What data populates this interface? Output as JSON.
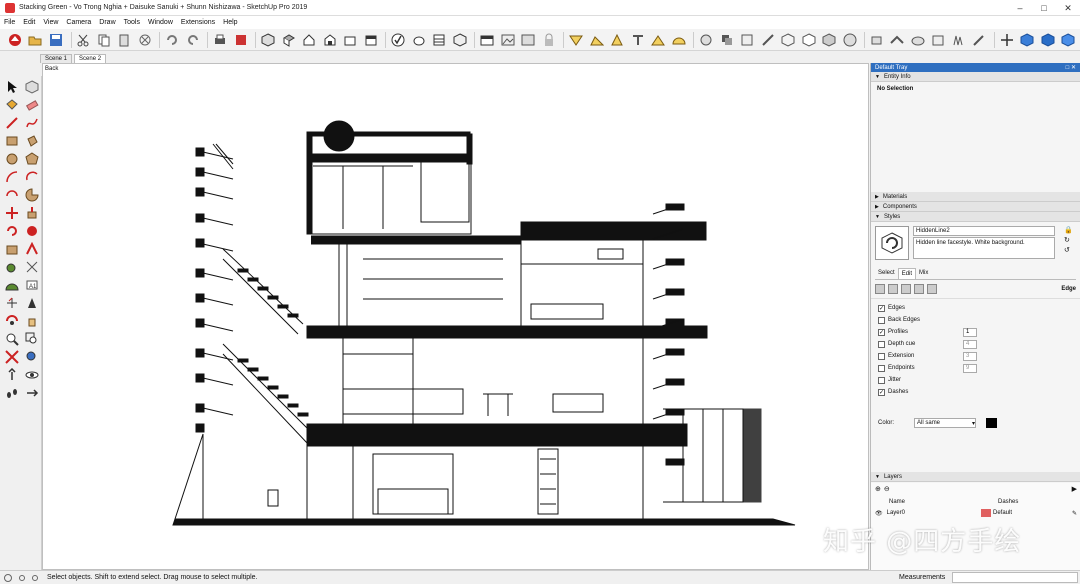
{
  "window": {
    "title": "Stacking Green - Vo Trong Nghia + Daisuke Sanuki + Shunn Nishizawa - SketchUp Pro 2019",
    "controls": [
      "minimize-icon",
      "maximize-icon",
      "close-icon"
    ]
  },
  "menu": [
    "File",
    "Edit",
    "View",
    "Camera",
    "Draw",
    "Tools",
    "Window",
    "Extensions",
    "Help"
  ],
  "scenes": [
    "Scene 1",
    "Scene 2"
  ],
  "viewport": {
    "back_label": "Back"
  },
  "tray": {
    "title": "Default Tray",
    "entity_info": {
      "title": "Entity Info",
      "selection": "No Selection"
    },
    "materials": "Materials",
    "components": "Components",
    "styles": {
      "title": "Styles",
      "name": "HiddenLine2",
      "description": "Hidden line facestyle. White background.",
      "tabs": [
        "Select",
        "Edit",
        "Mix"
      ],
      "active_tab": "Edit",
      "section_label": "Edge",
      "options": [
        {
          "label": "Edges",
          "checked": true
        },
        {
          "label": "Back Edges",
          "checked": false
        },
        {
          "label": "Profiles",
          "checked": true,
          "value": "1"
        },
        {
          "label": "Depth cue",
          "checked": false,
          "value": "4"
        },
        {
          "label": "Extension",
          "checked": false,
          "value": "3"
        },
        {
          "label": "Endpoints",
          "checked": false,
          "value": "9"
        },
        {
          "label": "Jitter",
          "checked": false
        },
        {
          "label": "Dashes",
          "checked": true
        }
      ],
      "color_label": "Color:",
      "color_value": "All same",
      "edge_color": "#000000"
    },
    "layers": {
      "title": "Layers",
      "col_name": "Name",
      "col_dashes": "Dashes",
      "rows": [
        {
          "name": "Layer0",
          "value": "Default",
          "color": "#e06060"
        }
      ]
    }
  },
  "status": {
    "text": "Select objects. Shift to extend select. Drag mouse to select multiple.",
    "measurements_label": "Measurements"
  },
  "watermark": "知乎 @四方手绘"
}
